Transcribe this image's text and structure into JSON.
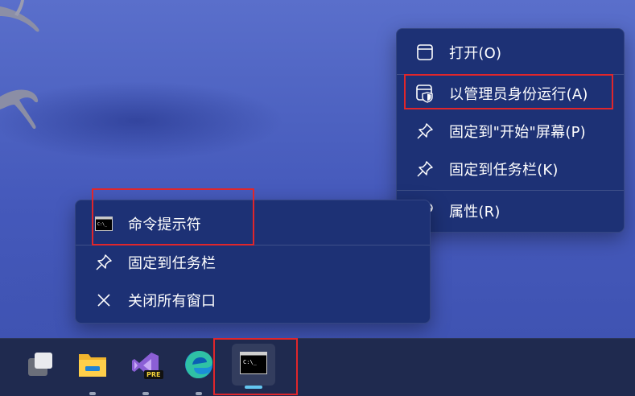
{
  "left_menu": {
    "items": [
      {
        "label": "命令提示符",
        "icon": "cmd-icon"
      },
      {
        "label": "固定到任务栏",
        "icon": "pin-icon"
      },
      {
        "label": "关闭所有窗口",
        "icon": "close-icon"
      }
    ]
  },
  "right_menu": {
    "items": [
      {
        "label": "打开(O)",
        "icon": "window-icon"
      },
      {
        "label": "以管理员身份运行(A)",
        "icon": "admin-shield-icon"
      },
      {
        "label": "固定到\"开始\"屏幕(P)",
        "icon": "pin-icon"
      },
      {
        "label": "固定到任务栏(K)",
        "icon": "pin-icon"
      },
      {
        "label": "属性(R)",
        "icon": "wrench-icon"
      }
    ]
  },
  "taskbar": {
    "apps": [
      {
        "name": "task-view",
        "icon": "task-view-icon"
      },
      {
        "name": "file-explorer",
        "icon": "folder-icon"
      },
      {
        "name": "visual-studio-preview",
        "icon": "visual-studio-icon",
        "badge": "PRE"
      },
      {
        "name": "edge",
        "icon": "edge-icon"
      },
      {
        "name": "command-prompt",
        "icon": "cmd-icon",
        "active": true
      }
    ]
  },
  "colors": {
    "highlight": "#e0262b",
    "menu_bg": "#1d3175",
    "taskbar_bg": "#1f2a4f",
    "indicator": "#63c6f0"
  }
}
